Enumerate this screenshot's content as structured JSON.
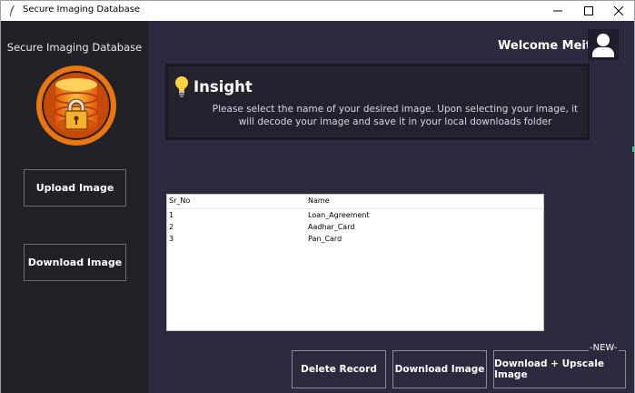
{
  "window": {
    "title": "Secure Imaging Database"
  },
  "sidebar": {
    "title": "Secure Imaging Database",
    "buttons": [
      {
        "label": "Upload Image"
      },
      {
        "label": "Download Image"
      }
    ]
  },
  "header": {
    "welcome": "Welcome Meit"
  },
  "insight": {
    "title": "Insight",
    "text": "Please select the name of your desired image. Upon selecting your image, it will decode your image and save it in your local downloads folder"
  },
  "table": {
    "columns": [
      "Sr_No",
      "Name"
    ],
    "rows": [
      [
        "1",
        "Loan_Agreement"
      ],
      [
        "2",
        "Aadhar_Card"
      ],
      [
        "3",
        "Pan_Card"
      ]
    ]
  },
  "actions": {
    "delete_label": "Delete Record",
    "download_label": "Download Image",
    "upscale_label": "Download + Upscale Image",
    "new_badge": "-NEW-"
  },
  "colors": {
    "sidebar_bg": "#212227",
    "main_bg": "#2b2a3e",
    "accent_orange": "#f28c1e",
    "text_white": "#ffffff"
  },
  "icons": {
    "app": "feather-icon",
    "logo": "database-lock-icon",
    "avatar": "user-icon",
    "insight": "lightbulb-icon"
  }
}
